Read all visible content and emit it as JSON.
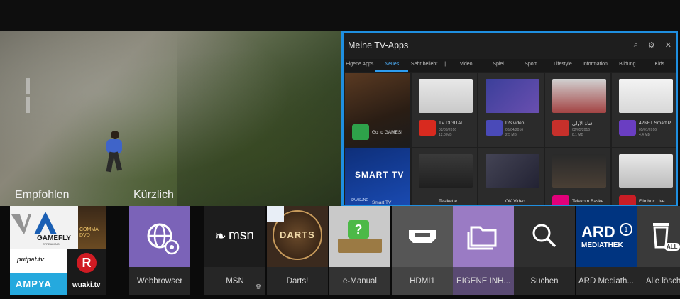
{
  "sections": {
    "recommended": "Empfohlen",
    "recent": "Kürzlich"
  },
  "panel": {
    "title": "Meine TV-Apps",
    "tabs": [
      "Eigene Apps",
      "Neues",
      "Sehr beliebt",
      "|",
      "Video",
      "Spiel",
      "Sport",
      "Lifestyle",
      "Information",
      "Bildung",
      "Kids"
    ],
    "active_tab": "Neues",
    "tiles": [
      {
        "name": "Go to GAMES!",
        "date": "",
        "size": ""
      },
      {
        "name": "TV DIGITAL",
        "date": "02/03/2016",
        "size": "12.0 MB"
      },
      {
        "name": "DS video",
        "date": "03/04/2016",
        "size": "2.5 MB"
      },
      {
        "name": "قناة الأولى",
        "date": "02/05/2016",
        "size": "8.1 MB"
      },
      {
        "name": "42NFT Smart P...",
        "date": "05/01/2016",
        "size": "4.4 MB"
      },
      {
        "name": "Smart TV",
        "date": "",
        "size": ""
      },
      {
        "name": "Testkette",
        "date": "",
        "size": ""
      },
      {
        "name": "OK Video",
        "date": "",
        "size": ""
      },
      {
        "name": "Telekom Baske...",
        "date": "",
        "size": ""
      },
      {
        "name": "Filmbox Live",
        "date": "",
        "size": ""
      }
    ],
    "smart_tv_brand": "SAMSUNG",
    "smart_tv_logo": "SMART TV",
    "tv_badge": "TV"
  },
  "recommended": {
    "gamefly": "GAMEFLY",
    "gamefly_sub": "STREAMING",
    "commando": "COMMA DVD",
    "putpat": "putpat.tv",
    "ampya": "AMPYA",
    "wuaki_letter": "R",
    "wuaki": "wuaki.tv"
  },
  "apps": [
    {
      "label": "Webbrowser",
      "icon": "globe-icon"
    },
    {
      "label": "MSN",
      "icon": "msn-logo-icon",
      "logo_text": "msn"
    },
    {
      "label": "Darts!",
      "icon": "darts-icon",
      "logo_text": "DARTS"
    },
    {
      "label": "e-Manual",
      "icon": "book-icon",
      "logo_text": "?"
    },
    {
      "label": "HDMI1",
      "icon": "hdmi-icon"
    },
    {
      "label": "EIGENE INH...",
      "icon": "folder-icon"
    },
    {
      "label": "Suchen",
      "icon": "search-icon"
    },
    {
      "label": "ARD Mediath...",
      "icon": "ard-icon",
      "logo_text": "ARD",
      "logo_sub": "MEDIATHEK"
    },
    {
      "label": "Alle lösch",
      "icon": "trash-icon",
      "logo_text": "ALL"
    }
  ],
  "colors": {
    "accent": "#1f8fe0",
    "browser": "#7b63b8",
    "folder": "#9a7bc4",
    "ard": "#003480"
  }
}
